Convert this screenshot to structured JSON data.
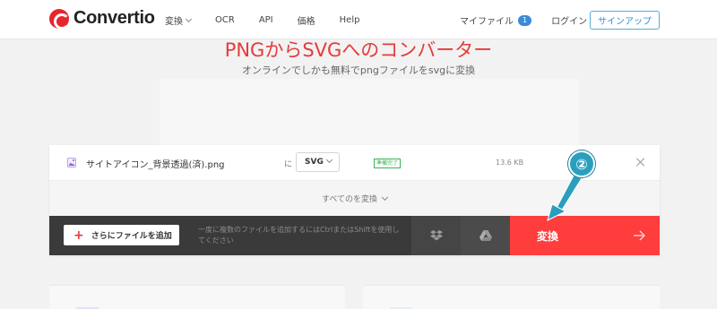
{
  "header": {
    "logo_text": "Convertio",
    "nav": [
      {
        "label": "変換",
        "has_dropdown": true
      },
      {
        "label": "OCR"
      },
      {
        "label": "API"
      },
      {
        "label": "価格"
      },
      {
        "label": "Help"
      }
    ],
    "my_files_label": "マイファイル",
    "my_files_count": "1",
    "login_label": "ログイン",
    "signup_label": "サインアップ"
  },
  "hero": {
    "title": "PNGからSVGへのコンバーター",
    "subtitle": "オンラインでしかも無料でpngファイルをsvgに変換"
  },
  "file": {
    "name": "サイトアイコン_背景透過(済).png",
    "to_label": "に",
    "format": "SVG",
    "status": "準備完了",
    "size": "13.6 KB"
  },
  "convert_all_label": "すべてのを変換",
  "actions": {
    "add_files_label": "さらにファイルを追加",
    "hint": "一度に複数のファイルを追加するにはCtrlまたはShiftを使用してください",
    "convert_label": "変換"
  },
  "annotation": {
    "number": "②"
  },
  "colors": {
    "brand_red": "#e43c3c",
    "convert_button": "#ff3d3d",
    "action_bar": "#3a3a3a",
    "link_blue": "#2f8fd0",
    "status_green": "#3fae5a",
    "callout": "#2a9fbd"
  },
  "icons": {
    "logo": "convertio-logo-icon",
    "file": "image-file-icon",
    "dropbox": "dropbox-icon",
    "gdrive": "google-drive-icon",
    "close": "close-icon",
    "arrow": "arrow-right-icon"
  }
}
